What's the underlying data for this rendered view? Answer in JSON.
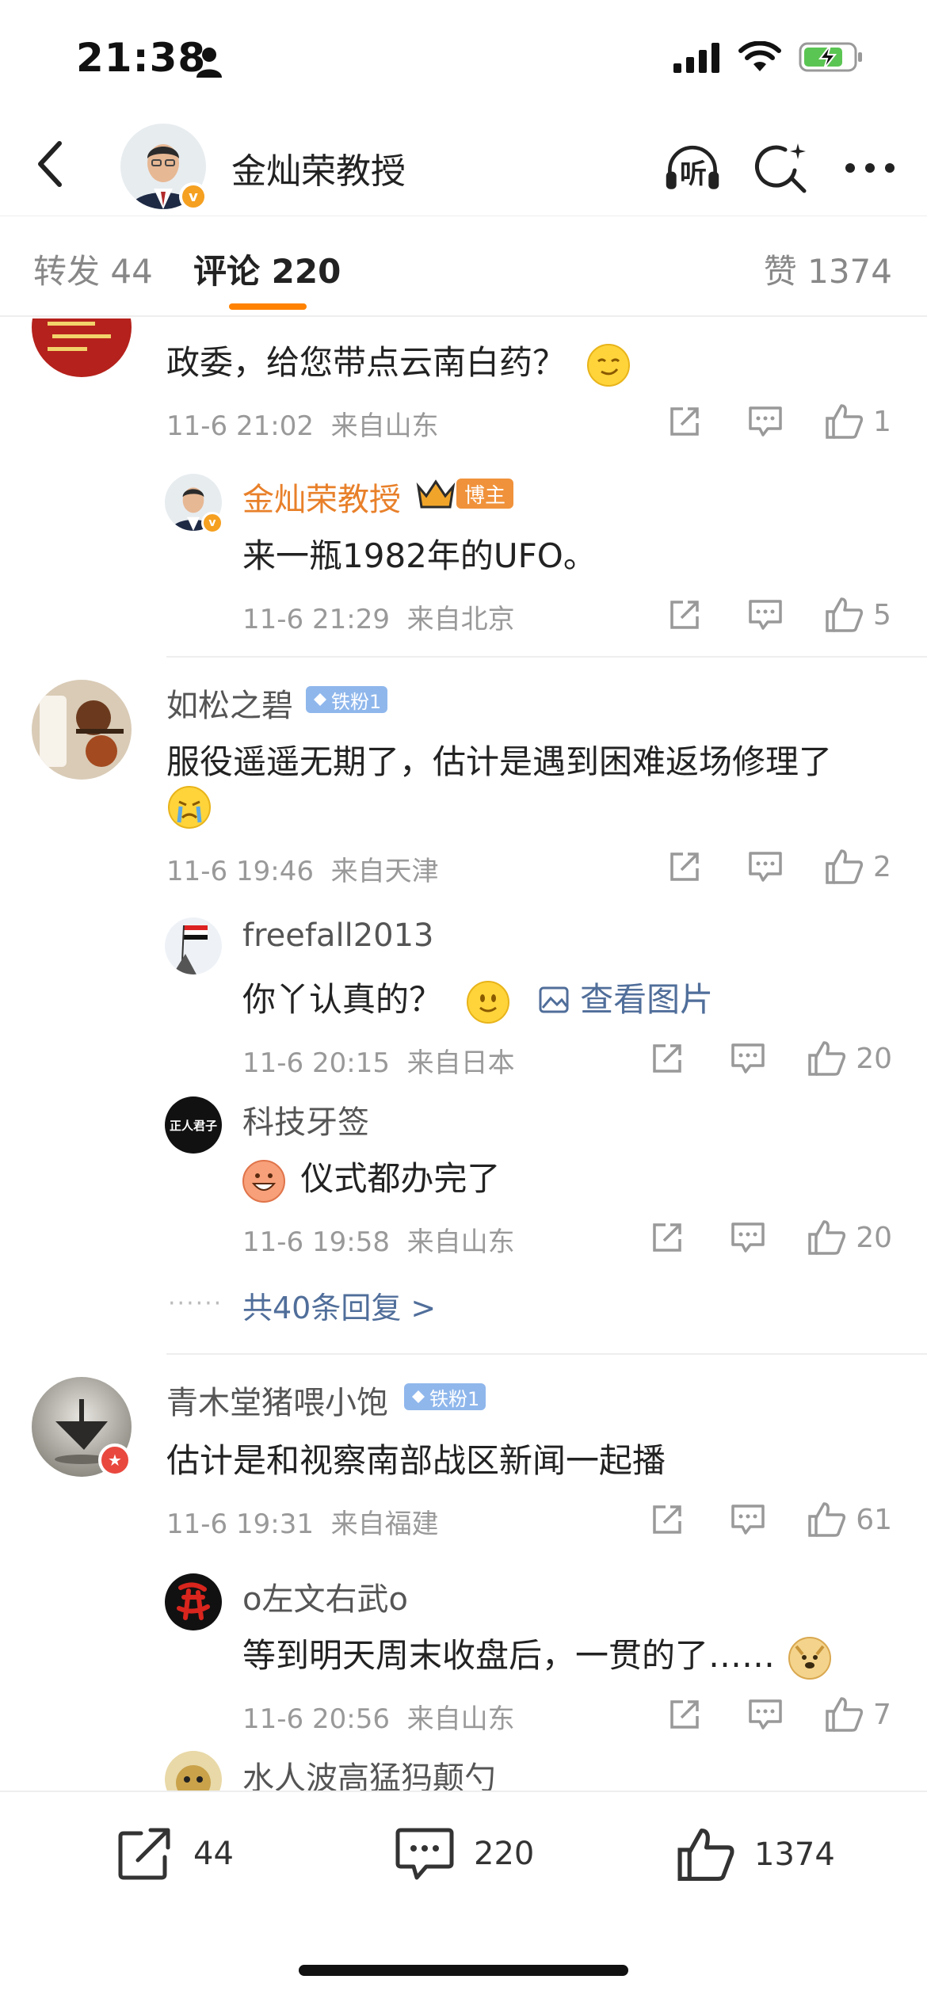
{
  "status": {
    "time": "21:38"
  },
  "header": {
    "title": "金灿荣教授",
    "listen_label": "听"
  },
  "tabs": [
    {
      "label": "转发 44"
    },
    {
      "label": "评论 220"
    },
    {
      "label": "赞 1374"
    }
  ],
  "comments": [
    {
      "text": "政委，给您带点云南白药？",
      "time": "11-6 21:02",
      "location": "来自山东",
      "likes": "1",
      "replies": [
        {
          "user": "金灿荣教授",
          "badge": "博主",
          "text": "来一瓶1982年的UFO。",
          "time": "11-6 21:29",
          "location": "来自北京",
          "likes": "5"
        }
      ]
    },
    {
      "user": "如松之碧",
      "badge": "铁粉1",
      "text_line1": "服役遥遥无期了，估计是遇到困难返场修理了",
      "time": "11-6 19:46",
      "location": "来自天津",
      "likes": "2",
      "replies": [
        {
          "user": "freefall2013",
          "text": "你丫认真的？",
          "view_image": "查看图片",
          "time": "11-6 20:15",
          "location": "来自日本",
          "likes": "20"
        },
        {
          "user": "科技牙签",
          "avatar_text": "正人君子",
          "text": "仪式都办完了",
          "time": "11-6 19:58",
          "location": "来自山东",
          "likes": "20"
        }
      ],
      "more_replies": "共40条回复 >"
    },
    {
      "user": "青木堂猪喂小饱",
      "badge": "铁粉1",
      "text": "估计是和视察南部战区新闻一起播",
      "time": "11-6 19:31",
      "location": "来自福建",
      "likes": "61",
      "replies": [
        {
          "user": "o左文右武o",
          "text": "等到明天周末收盘后，一贯的了……",
          "time": "11-6 20:56",
          "location": "来自山东",
          "likes": "7"
        },
        {
          "user": "水人波高猛犸颠勺"
        }
      ]
    }
  ],
  "bottom_bar": {
    "reposts": "44",
    "comments": "220",
    "likes": "1374"
  },
  "colors": {
    "accent": "#ff8200",
    "owner_name": "#e8802a",
    "link": "#506e9a",
    "fan_badge": "#8fb7ec"
  }
}
